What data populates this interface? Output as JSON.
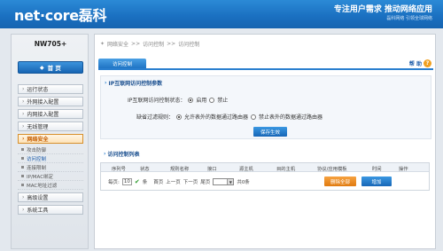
{
  "header": {
    "logo": "net·core磊科",
    "slogan": "专注用户需求  推动网络应用",
    "slogan_sub": "磊科网络 引领全球网络"
  },
  "sidebar": {
    "model": "NW705+",
    "home": "首  页",
    "items": [
      {
        "label": "运行状态"
      },
      {
        "label": "外网接入配置"
      },
      {
        "label": "内网接入配置"
      },
      {
        "label": "无线管理"
      },
      {
        "label": "网络安全"
      }
    ],
    "subitems": [
      {
        "label": "攻击防御"
      },
      {
        "label": "访问控制"
      },
      {
        "label": "连接限制"
      },
      {
        "label": "IP/MAC绑定"
      },
      {
        "label": "MAC地址过滤"
      }
    ],
    "items_after": [
      {
        "label": "高级设置"
      },
      {
        "label": "系统工具"
      }
    ]
  },
  "breadcrumb": {
    "part1": "网络安全",
    "sep1": ">>",
    "part2": "访问控制",
    "sep2": ">>",
    "part3": "访问控制"
  },
  "tab": {
    "label": "访问控制",
    "help": "帮 助",
    "help_icon": "?"
  },
  "params": {
    "title": "IP互联网访问控制参数",
    "status_label": "IP互联网访问控制状态：",
    "enable": "启用",
    "disable": "禁止",
    "rule_label": "缺省过滤规则：",
    "rule_allow": "允许表外的数据通过路由器",
    "rule_deny": "禁止表外的数据通过路由器",
    "save": "保存生效"
  },
  "list": {
    "title": "访问控制列表",
    "columns": [
      "序列号",
      "状态",
      "规则名称",
      "接口",
      "源主机",
      "目的主机",
      "协议/应用模板",
      "时间",
      "操作"
    ],
    "per_page_label": "每页:",
    "per_page_value": "10",
    "per_page_unit": "条",
    "first": "首页",
    "prev": "上一页",
    "next": "下一页",
    "last": "尾页",
    "total": "共0条",
    "delete_all": "删除全部",
    "add": "增加"
  }
}
